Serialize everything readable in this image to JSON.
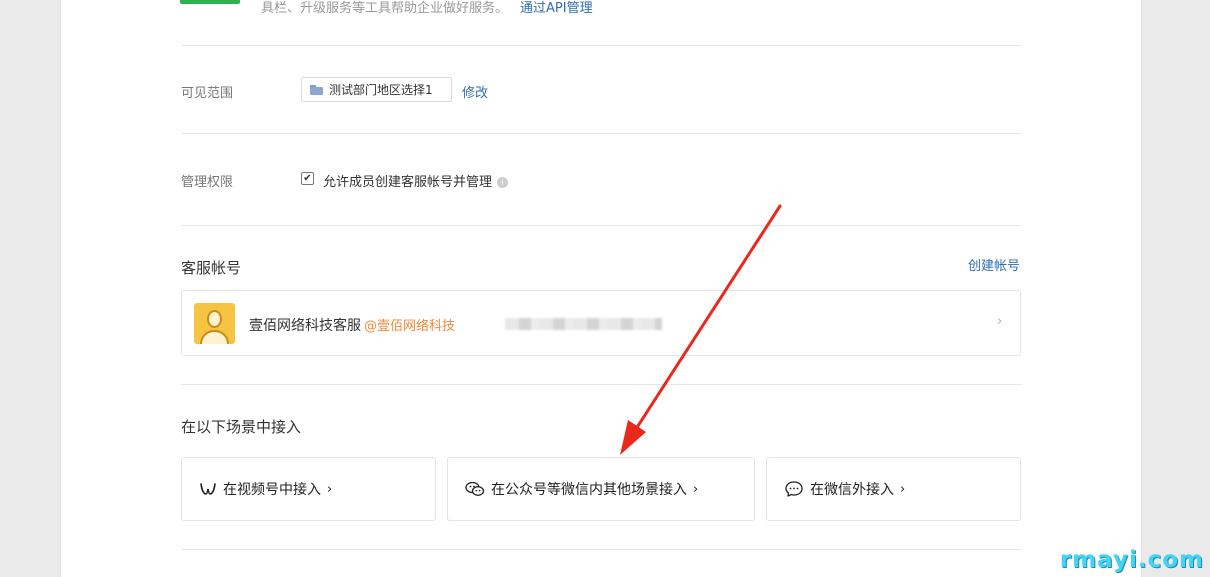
{
  "top": {
    "desc": "具栏、升级服务等工具帮助企业做好服务。",
    "api_link": "通过API管理"
  },
  "visibility": {
    "label": "可见范围",
    "dept": "测试部门地区选择1",
    "edit_link": "修改"
  },
  "permission": {
    "label": "管理权限",
    "checkbox_label": "允许成员创建客服帐号并管理",
    "checked": true
  },
  "accounts": {
    "title": "客服帐号",
    "create_link": "创建帐号",
    "items": [
      {
        "name": "壹佰网络科技客服",
        "org": "@壹佰网络科技"
      }
    ]
  },
  "scenes": {
    "title": "在以下场景中接入",
    "items": [
      {
        "label": "在视频号中接入",
        "icon": "channels-icon"
      },
      {
        "label": "在公众号等微信内其他场景接入",
        "icon": "wechat-icon"
      },
      {
        "label": "在微信外接入",
        "icon": "chat-bubble-icon"
      }
    ],
    "arrow": "›"
  },
  "watermark": "rmayi.com",
  "colors": {
    "link": "#2f6fb0",
    "org": "#f0883a",
    "annotation_arrow": "#e8291c",
    "watermark": "#46d2f4"
  }
}
